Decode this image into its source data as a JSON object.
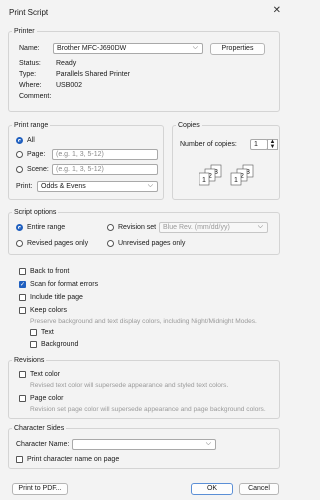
{
  "window": {
    "title": "Print Script"
  },
  "printer": {
    "legend": "Printer",
    "name_label": "Name:",
    "name_value": "Brother MFC-J690DW",
    "properties_label": "Properties",
    "status_label": "Status:",
    "status_value": "Ready",
    "type_label": "Type:",
    "type_value": "Parallels Shared Printer",
    "where_label": "Where:",
    "where_value": "USB002",
    "comment_label": "Comment:"
  },
  "print_range": {
    "legend": "Print range",
    "all_label": "All",
    "page_label": "Page:",
    "page_placeholder": "(e.g. 1, 3, 5-12)",
    "scene_label": "Scene:",
    "scene_placeholder": "(e.g. 1, 3, 5-12)",
    "print_label": "Print:",
    "print_value": "Odds & Evens"
  },
  "copies": {
    "legend": "Copies",
    "number_label": "Number of copies:",
    "number_value": "1"
  },
  "script_options": {
    "legend": "Script options",
    "entire_range": "Entire range",
    "revision_set": "Revision set",
    "revision_set_value": "Blue Rev. (mm/dd/yy)",
    "revised_pages_only": "Revised pages only",
    "unrevised_pages_only": "Unrevised pages only"
  },
  "options": {
    "back_to_front": "Back to front",
    "scan_for_format_errors": "Scan for format errors",
    "include_title_page": "Include title page",
    "keep_colors": "Keep colors",
    "keep_colors_desc": "Preserve background and text display colors, including Night/Midnight Modes.",
    "text": "Text",
    "background": "Background"
  },
  "revisions": {
    "legend": "Revisions",
    "text_color": "Text color",
    "text_color_desc": "Revised text color will supersede appearance and styled text colors.",
    "page_color": "Page color",
    "page_color_desc": "Revision set page color will supersede appearance and page background colors."
  },
  "character_sides": {
    "legend": "Character Sides",
    "character_name_label": "Character Name:",
    "character_name_value": "",
    "print_character_name": "Print character name on page"
  },
  "footer": {
    "print_to_pdf": "Print to PDF...",
    "ok": "OK",
    "cancel": "Cancel"
  }
}
